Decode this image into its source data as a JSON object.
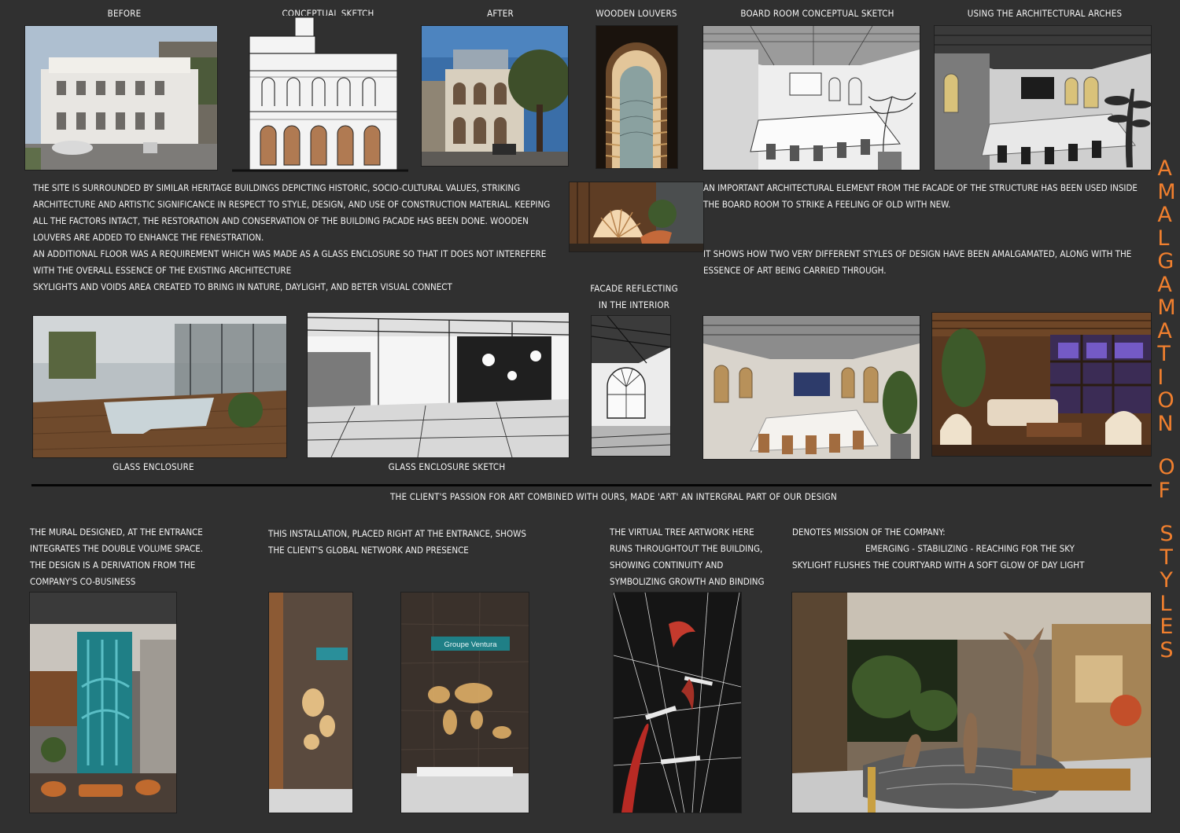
{
  "captions": {
    "before": "BEFORE",
    "conceptual_sketch": "CONCEPTUAL SKETCH",
    "after": "AFTER",
    "wooden_louvers": "WOODEN LOUVERS",
    "board_room_sketch": "BOARD ROOM CONCEPTUAL SKETCH",
    "arches": "USING THE ARCHITECTURAL ARCHES",
    "facade_reflecting_1": "FACADE REFLECTING",
    "facade_reflecting_2": "IN THE INTERIOR",
    "glass_enclosure": "GLASS ENCLOSURE",
    "glass_enclosure_sketch": "GLASS ENCLOSURE SKETCH",
    "art_banner": "THE CLIENT'S PASSION FOR ART COMBINED WITH OURS, MADE 'ART' AN INTERGRAL PART OF OUR DESIGN"
  },
  "site_text": [
    "THE SITE IS SURROUNDED BY SIMILAR HERITAGE BUILDINGS DEPICTING HISTORIC, SOCIO-CULTURAL VALUES, STRIKING",
    "ARCHITECTURE AND ARTISTIC SIGNIFICANCE IN RESPECT TO STYLE, DESIGN, AND USE OF CONSTRUCTION MATERIAL. KEEPING",
    "ALL THE FACTORS INTACT, THE RESTORATION AND CONSERVATION OF THE BUILDING FACADE HAS BEEN DONE. WOODEN",
    "LOUVERS ARE ADDED TO ENHANCE THE FENESTRATION.",
    "AN ADDITIONAL FLOOR WAS A REQUIREMENT WHICH WAS MADE AS A GLASS ENCLOSURE SO THAT IT DOES NOT INTEREFERE",
    "WITH THE OVERALL ESSENCE OF THE EXISTING ARCHITECTURE",
    "SKYLIGHTS AND VOIDS AREA CREATED TO BRING IN NATURE, DAYLIGHT, AND BETER VISUAL CONNECT"
  ],
  "element_text": [
    "AN IMPORTANT ARCHITECTURAL ELEMENT FROM THE FACADE OF THE STRUCTURE HAS BEEN USED INSIDE",
    "THE BOARD ROOM TO STRIKE A FEELING OF OLD WITH NEW."
  ],
  "styles_text": [
    "IT SHOWS HOW TWO VERY DIFFERENT STYLES OF DESIGN HAVE BEEN AMALGAMATED, ALONG WITH THE",
    "ESSENCE OF ART BEING CARRIED THROUGH."
  ],
  "mural_text": [
    "THE MURAL DESIGNED, AT THE ENTRANCE",
    "INTEGRATES THE DOUBLE VOLUME SPACE.",
    "THE DESIGN IS A DERIVATION FROM THE",
    "COMPANY'S CO-BUSINESS"
  ],
  "installation_text": [
    "THIS INSTALLATION, PLACED RIGHT AT THE ENTRANCE, SHOWS",
    "THE CLIENT'S GLOBAL NETWORK AND PRESENCE"
  ],
  "tree_text": [
    "THE VIRTUAL TREE ARTWORK  HERE",
    "RUNS THROUGHTOUT THE BUILDING,",
    "SHOWING CONTINUITY AND",
    "SYMBOLIZING GROWTH AND BINDING"
  ],
  "mission_text": [
    "DENOTES MISSION OF THE COMPANY:",
    "EMERGING - STABILIZING - REACHING FOR THE SKY",
    "SKYLIGHT FLUSHES THE COURTYARD WITH A SOFT GLOW OF DAY LIGHT"
  ],
  "vertical_title": {
    "word1": "AMALGAMATION",
    "word2": "OF",
    "word3": "STYLES"
  },
  "sign_text": "Groupe Ventura",
  "colors": {
    "background": "#303030",
    "title_orange": "#f07f2e",
    "divider": "#050505"
  }
}
